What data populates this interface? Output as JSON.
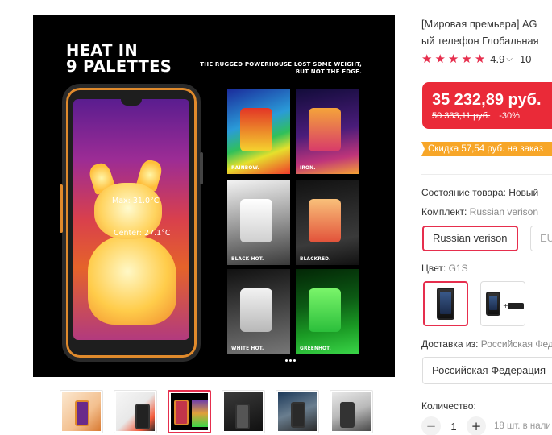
{
  "product_image": {
    "headline_line1": "HEAT IN",
    "headline_line2": "9 PALETTES",
    "subline_line1": "THE RUGGED POWERHOUSE LOST SOME WEIGHT,",
    "subline_line2": "BUT NOT THE EDGE.",
    "readout_max": "Max: 31.0°C",
    "readout_center": "Center: 27.1°C",
    "palettes": [
      "RAINBOW.",
      "IRON.",
      "BLACK HOT.",
      "BLACKRED.",
      "WHITE HOT.",
      "GREENHOT."
    ]
  },
  "thumbnails": {
    "count": 6,
    "active_index": 2
  },
  "product": {
    "title_line1": "[Мировая премьера] AG",
    "title_line2": "ый телефон Глобальная",
    "rating_stars": 5,
    "rating_value": "4.9",
    "rating_count": "10",
    "price": "35 232,89 руб.",
    "old_price": "50 333,11 руб.",
    "discount": "-30%",
    "promo": "Скидка 57,54 руб. на заказ"
  },
  "attributes": {
    "condition_label": "Состояние товара:",
    "condition_value": "Новый",
    "kit_label": "Комплект:",
    "kit_value": "Russian verison",
    "kit_options": [
      "Russian verison",
      "EU"
    ],
    "color_label": "Цвет:",
    "color_value": "G1S",
    "color_options_plus": "+",
    "ship_label": "Доставка из:",
    "ship_value": "Российская Фед",
    "ship_selected": "Российская Федерация",
    "qty_label": "Количество:",
    "qty_value": "1",
    "qty_minus": "−",
    "qty_plus": "+",
    "stock": "18 шт. в нали"
  },
  "colors": {
    "accent": "#e62e4d",
    "price_bg": "#ea2a38",
    "promo_bg": "#f7a628"
  }
}
